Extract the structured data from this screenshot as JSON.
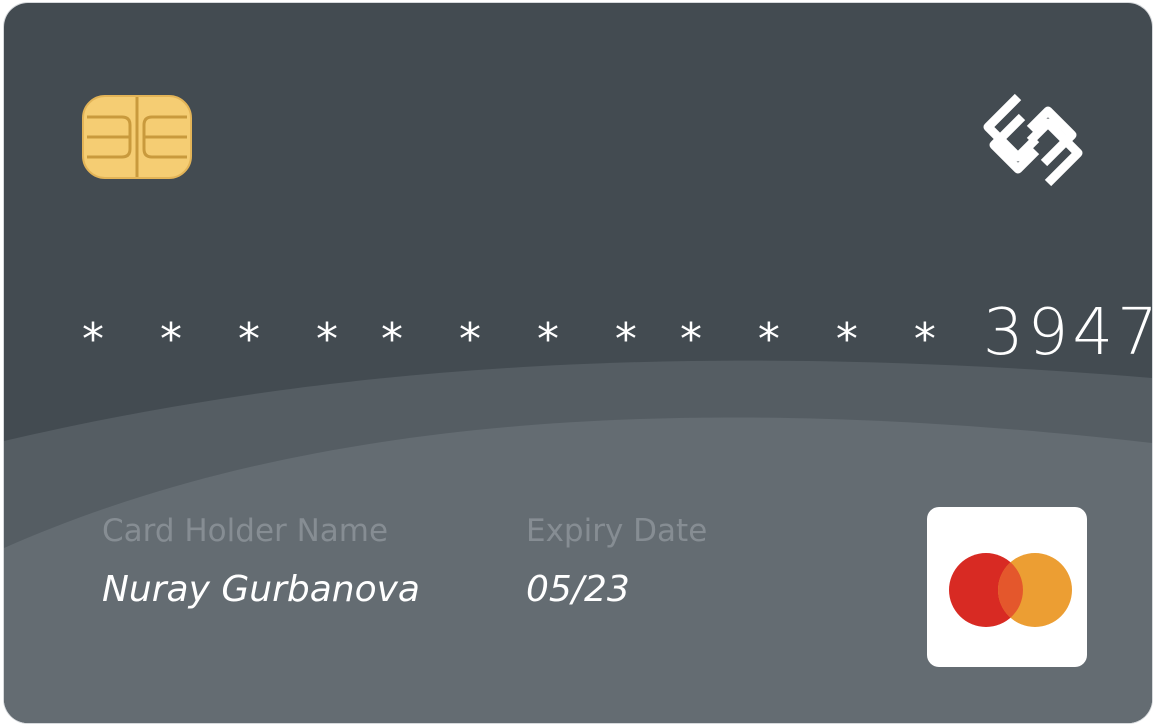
{
  "card": {
    "number_masked_groups": [
      "* * * *",
      "* * * *",
      "* * * *"
    ],
    "last_four": "3947",
    "holder_label": "Card Holder Name",
    "holder_name": "Nuray Gurbanova",
    "expiry_label": "Expiry Date",
    "expiry_value": "05/23",
    "chip_icon": "chip-icon",
    "brand_icon": "interlocking-squares-logo-icon",
    "network_icon": "mastercard-logo-icon"
  },
  "colors": {
    "card_background": "#434b51",
    "wave_light": "#5b6369",
    "wave_lighter": "#646c72",
    "chip_gold": "#f5cd73",
    "label_gray": "#868d93",
    "mastercard_red": "#d82a23",
    "mastercard_orange": "#ec9e33"
  }
}
